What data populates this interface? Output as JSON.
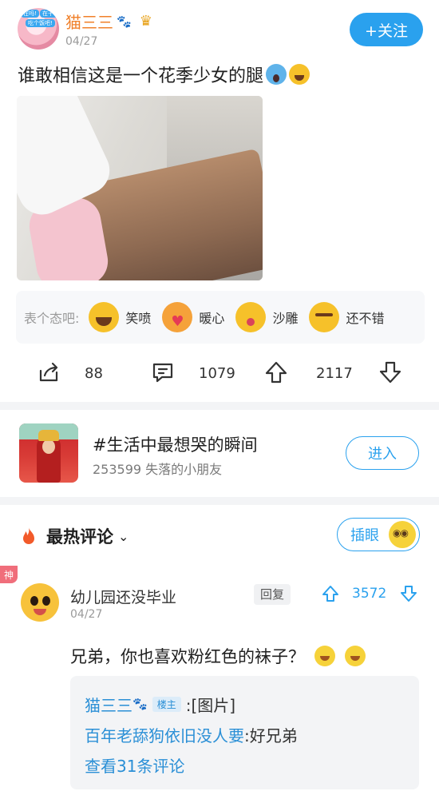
{
  "post": {
    "author": "猫三三",
    "date": "04/27",
    "follow_label": "+关注",
    "avatar_badges": [
      "在吗!",
      "在干嘛!",
      "吃个饭吧!"
    ],
    "text": "谁敢相信这是一个花季少女的腿",
    "text_emojis": [
      "scream-icon",
      "crying-icon"
    ]
  },
  "reactions": {
    "prompt": "表个态吧:",
    "items": [
      {
        "label": "笑喷",
        "icon": "laughing-emoji-icon"
      },
      {
        "label": "暖心",
        "icon": "heart-hug-emoji-icon"
      },
      {
        "label": "沙雕",
        "icon": "silly-emoji-icon"
      },
      {
        "label": "还不错",
        "icon": "smug-emoji-icon"
      }
    ]
  },
  "actions": {
    "share_count": "88",
    "comment_count": "1079",
    "upvote_count": "2117"
  },
  "topic": {
    "title": "#生活中最想哭的瞬间",
    "subtitle": "253599 失落的小朋友",
    "enter_label": "进入"
  },
  "comments_header": {
    "title": "最热评论",
    "insert_label": "插眼"
  },
  "comment": {
    "god_tag": "神",
    "name": "幼儿园还没毕业",
    "date": "04/27",
    "reply_label": "回复",
    "votes": "3572",
    "text": "兄弟，你也喜欢粉红色的袜子？",
    "replies": [
      {
        "name": "猫三三",
        "op_tag": "楼主",
        "text": ":[图片]"
      },
      {
        "name": "百年老舔狗依旧没人要",
        "text": ":好兄弟"
      }
    ],
    "view_more": "查看31条评论"
  },
  "colors": {
    "accent": "#2aa1ee",
    "author_orange": "#f0802a",
    "link_blue": "#2a8fd6",
    "divider": "#f3f4f6"
  }
}
